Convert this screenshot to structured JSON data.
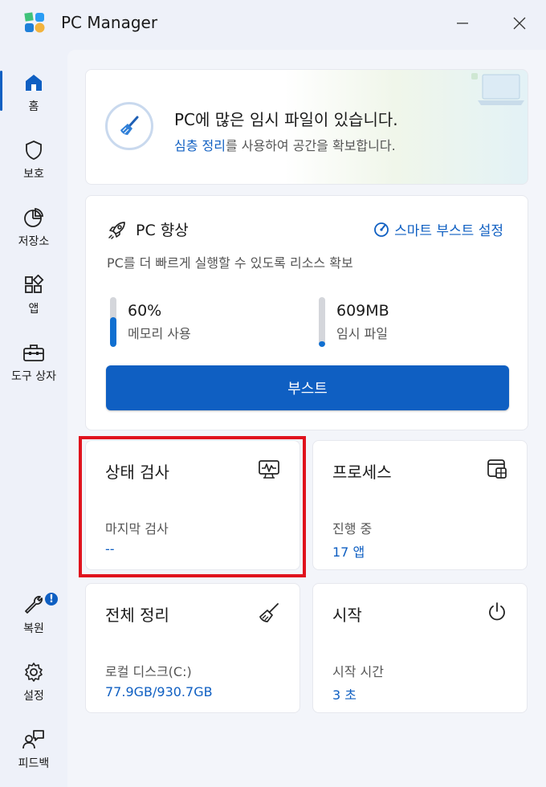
{
  "app": {
    "title": "PC Manager",
    "logo_icon": "pc-manager-logo-icon",
    "accent_color": "#0f5fc2",
    "highlight_color": "#e0121d"
  },
  "sidebar": {
    "items": [
      {
        "label": "홈",
        "icon": "home-icon",
        "active": true
      },
      {
        "label": "보호",
        "icon": "shield-icon"
      },
      {
        "label": "저장소",
        "icon": "pie-chart-icon"
      },
      {
        "label": "앱",
        "icon": "apps-icon"
      },
      {
        "label": "도구 상자",
        "icon": "toolbox-icon"
      }
    ],
    "bottom_items": [
      {
        "label": "복원",
        "icon": "wrench-icon",
        "badge": "!"
      },
      {
        "label": "설정",
        "icon": "gear-icon"
      },
      {
        "label": "피드백",
        "icon": "feedback-icon"
      }
    ]
  },
  "banner": {
    "title": "PC에 많은 임시 파일이 있습니다.",
    "link_text": "심층 정리",
    "subtitle_rest": "를 사용하여 공간을 확보합니다.",
    "icon": "broom-icon"
  },
  "boost": {
    "title": "PC 향상",
    "icon": "rocket-icon",
    "smart_boost_label": "스마트 부스트 설정",
    "smart_boost_icon": "gauge-icon",
    "description": "PC를 더 빠르게 실행할 수 있도록 리소스 확보",
    "memory": {
      "value": "60%",
      "label": "메모리 사용",
      "fill_percent": 60
    },
    "temp_files": {
      "value": "609MB",
      "label": "임시 파일",
      "fill_percent": 12
    },
    "button_label": "부스트"
  },
  "tiles": {
    "health_check": {
      "title": "상태 검사",
      "icon": "health-monitor-icon",
      "label": "마지막 검사",
      "value": "--"
    },
    "processes": {
      "title": "프로세스",
      "icon": "process-window-icon",
      "label": "진행 중",
      "value": "17 앱"
    },
    "full_cleanup": {
      "title": "전체 정리",
      "icon": "broom-icon",
      "label": "로컬 디스크(C:)",
      "value": "77.9GB/930.7GB"
    },
    "startup": {
      "title": "시작",
      "icon": "power-icon",
      "label": "시작 시간",
      "value": "3 초"
    }
  }
}
